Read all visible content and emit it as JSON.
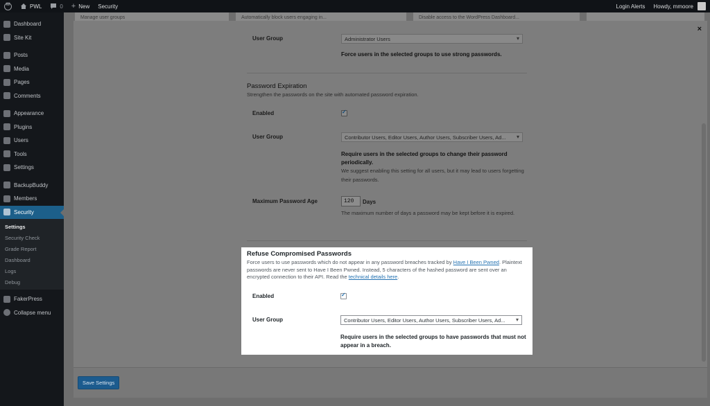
{
  "adminbar": {
    "site_name": "PWL",
    "comments_count": "0",
    "new_label": "New",
    "security_label": "Security",
    "login_alerts": "Login Alerts",
    "howdy": "Howdy, mmoore"
  },
  "sidebar": {
    "items": [
      {
        "label": "Dashboard",
        "icon": "dashboard-icon"
      },
      {
        "label": "Site Kit",
        "icon": "sitekit-icon"
      },
      {
        "label": "Posts",
        "icon": "pin-icon"
      },
      {
        "label": "Media",
        "icon": "media-icon"
      },
      {
        "label": "Pages",
        "icon": "page-icon"
      },
      {
        "label": "Comments",
        "icon": "comment-icon"
      },
      {
        "label": "Appearance",
        "icon": "brush-icon"
      },
      {
        "label": "Plugins",
        "icon": "plug-icon"
      },
      {
        "label": "Users",
        "icon": "user-icon"
      },
      {
        "label": "Tools",
        "icon": "wrench-icon"
      },
      {
        "label": "Settings",
        "icon": "settings-icon"
      },
      {
        "label": "BackupBuddy",
        "icon": "backup-icon"
      },
      {
        "label": "Members",
        "icon": "members-icon"
      },
      {
        "label": "Security",
        "icon": "shield-icon"
      },
      {
        "label": "FakerPress",
        "icon": "faker-icon"
      },
      {
        "label": "Collapse menu",
        "icon": "collapse-icon"
      }
    ],
    "submenu": [
      "Settings",
      "Security Check",
      "Grade Report",
      "Dashboard",
      "Logs",
      "Debug"
    ]
  },
  "background": {
    "col1": "Manage user groups",
    "col2": "Automatically block users engaging in...",
    "col3": "Disable access to the WordPress Dashboard..."
  },
  "modal": {
    "close": "×",
    "save_label": "Save Settings",
    "strong_passwords": {
      "user_group_label": "User Group",
      "user_group_value": "Administrator Users",
      "help": "Force users in the selected groups to use strong passwords."
    },
    "password_expiration": {
      "title": "Password Expiration",
      "description": "Strengthen the passwords on the site with automated password expiration.",
      "enabled_label": "Enabled",
      "user_group_label": "User Group",
      "user_group_value": "Contributor Users, Editor Users, Author Users, Subscriber Users, Ad...",
      "help_strong": "Require users in the selected groups to change their password periodically.",
      "help": "We suggest enabling this setting for all users, but it may lead to users forgetting their passwords.",
      "max_age_label": "Maximum Password Age",
      "max_age_value": "120",
      "max_age_unit": "Days",
      "max_age_help": "The maximum number of days a password may be kept before it is expired."
    },
    "refuse_compromised": {
      "title": "Refuse Compromised Passwords",
      "desc_1": "Force users to use passwords which do not appear in any password breaches tracked by ",
      "link_1": "Have I Been Pwned",
      "desc_2": ". Plaintext passwords are never sent to Have I Been Pwned. Instead, 5 characters of the hashed password are sent over an encrypted connection to their API. Read the ",
      "link_2": "technical details here",
      "desc_3": ".",
      "enabled_label": "Enabled",
      "user_group_label": "User Group",
      "user_group_value": "Contributor Users, Editor Users, Author Users, Subscriber Users, Ad...",
      "help_strong": "Require users in the selected groups to have passwords that must not appear in a breach."
    }
  }
}
